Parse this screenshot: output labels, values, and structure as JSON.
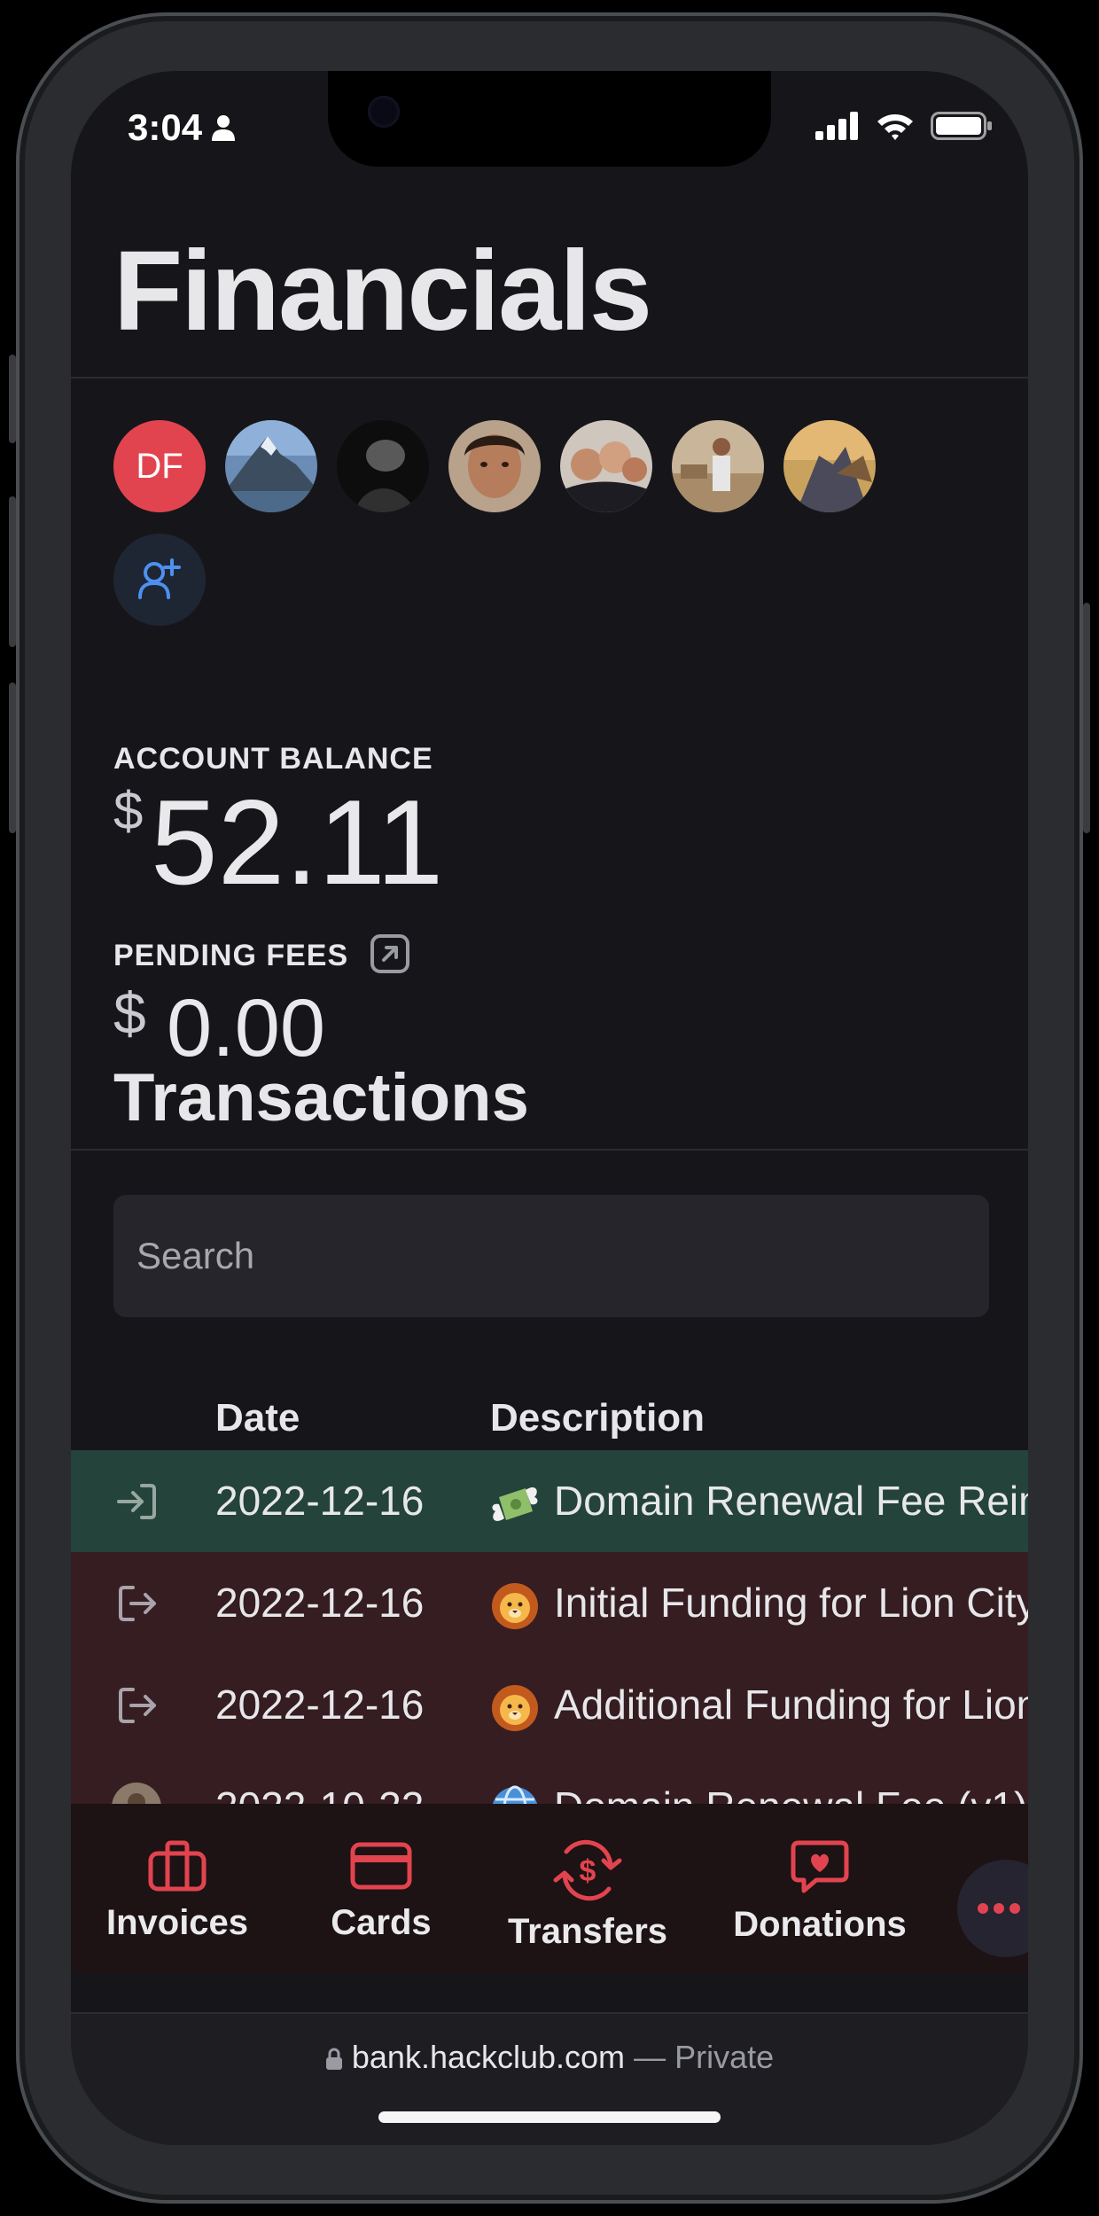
{
  "status_bar": {
    "time": "3:04"
  },
  "page": {
    "title": "Financials"
  },
  "members": {
    "initials_avatar": "DF",
    "photo_avatars": [
      "mountain-photo",
      "dark-portrait",
      "portrait",
      "group-selfie",
      "room-photo",
      "fantasy-art"
    ]
  },
  "balance": {
    "label": "ACCOUNT BALANCE",
    "currency": "$",
    "amount": "52.11"
  },
  "pending_fees": {
    "label": "PENDING FEES",
    "currency": "$",
    "amount": "0.00"
  },
  "transactions": {
    "title": "Transactions",
    "search_placeholder": "Search",
    "columns": {
      "date": "Date",
      "description": "Description"
    },
    "rows": [
      {
        "date": "2022-12-16",
        "description": "Domain Renewal Fee Reimbursement",
        "direction": "in",
        "emoji": "money-with-wings"
      },
      {
        "date": "2022-12-16",
        "description": "Initial Funding for Lion City",
        "direction": "out",
        "emoji": "lion-face"
      },
      {
        "date": "2022-12-16",
        "description": "Additional Funding for Lion City",
        "direction": "out",
        "emoji": "lion-face"
      },
      {
        "date": "2022-10-22",
        "description": "Domain Renewal Fee (v1)",
        "direction": "out",
        "emoji": "globe"
      }
    ]
  },
  "bottom_nav": {
    "items": [
      {
        "label": "Invoices",
        "icon": "briefcase-icon"
      },
      {
        "label": "Cards",
        "icon": "card-icon"
      },
      {
        "label": "Transfers",
        "icon": "transfer-icon"
      },
      {
        "label": "Donations",
        "icon": "heart-message-icon"
      }
    ],
    "more_icon": "ellipsis-icon"
  },
  "browser": {
    "url": "bank.hackclub.com",
    "separator": "—",
    "mode": "Private"
  },
  "colors": {
    "accent": "#e2444f",
    "background": "#16161a",
    "income_row": "#24433a",
    "expense_row": "#351d22",
    "nav_background": "#1d1214"
  }
}
